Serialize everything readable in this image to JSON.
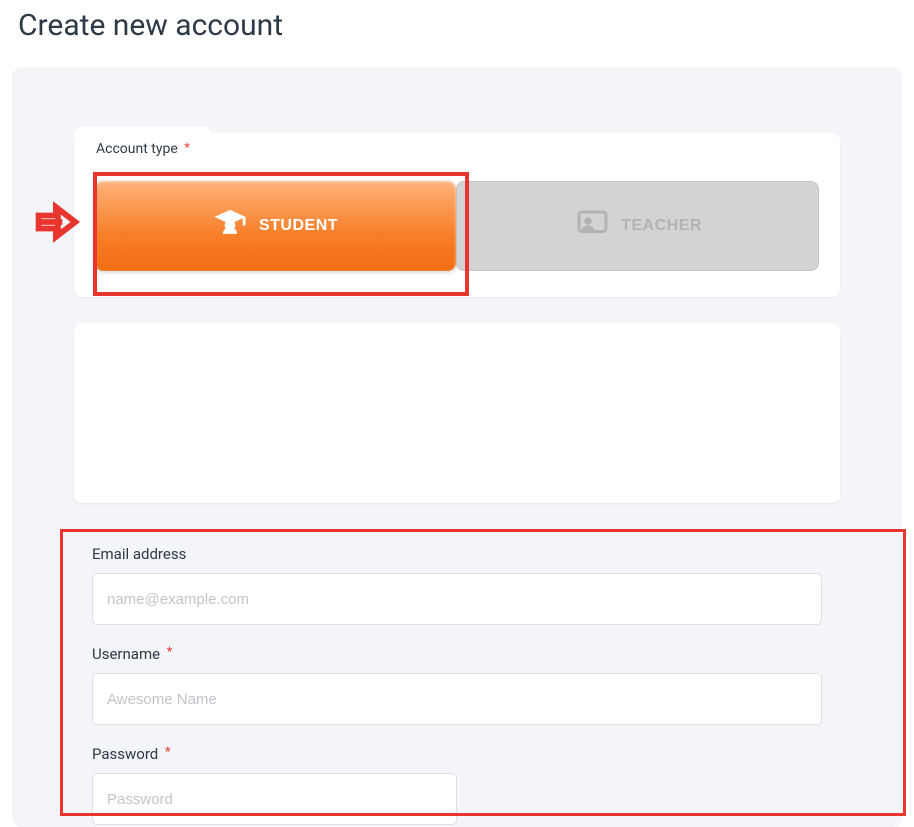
{
  "page": {
    "title": "Create new account"
  },
  "account_type": {
    "tab_label": "Account type",
    "options": [
      {
        "label": "STUDENT",
        "icon": "student-icon",
        "active": true
      },
      {
        "label": "TEACHER",
        "icon": "teacher-icon",
        "active": false
      }
    ]
  },
  "form": {
    "email": {
      "label": "Email address",
      "placeholder": "name@example.com",
      "value": ""
    },
    "username": {
      "label": "Username",
      "placeholder": "Awesome Name",
      "value": ""
    },
    "password": {
      "label": "Password",
      "placeholder": "Password",
      "value": ""
    }
  },
  "required_marker": "*"
}
